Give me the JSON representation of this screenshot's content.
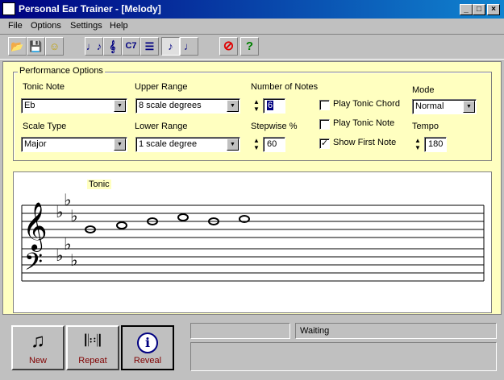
{
  "window": {
    "title": "Personal Ear Trainer - [Melody]"
  },
  "caption_buttons": [
    "_",
    "□",
    "×"
  ],
  "menu": [
    "File",
    "Options",
    "Settings",
    "Help"
  ],
  "toolbar": [
    {
      "icon": "open-folder-icon",
      "glyph": "📂"
    },
    {
      "icon": "save-icon",
      "glyph": "💾"
    },
    {
      "icon": "smiley-icon",
      "glyph": "☺"
    },
    {
      "icon": "interval-icon",
      "glyph": "♩♪"
    },
    {
      "icon": "scale-icon",
      "glyph": "𝄞"
    },
    {
      "icon": "chord-icon",
      "glyph": "C7"
    },
    {
      "icon": "progression-icon",
      "glyph": "☰"
    },
    {
      "icon": "melody-icon",
      "glyph": "♪"
    },
    {
      "icon": "rhythm-icon",
      "glyph": "♩"
    },
    {
      "icon": "stop-icon",
      "glyph": "⊘"
    },
    {
      "icon": "help-icon",
      "glyph": "?"
    }
  ],
  "performance": {
    "legend": "Performance Options",
    "tonic_note_label": "Tonic Note",
    "tonic_note": "Eb",
    "scale_type_label": "Scale Type",
    "scale_type": "Major",
    "upper_range_label": "Upper Range",
    "upper_range": "8 scale degrees",
    "lower_range_label": "Lower Range",
    "lower_range": "1 scale degree",
    "num_notes_label": "Number of Notes",
    "num_notes": "6",
    "stepwise_label": "Stepwise %",
    "stepwise": "60",
    "play_tonic_chord_label": "Play Tonic Chord",
    "play_tonic_chord": false,
    "play_tonic_note_label": "Play Tonic Note",
    "play_tonic_note": false,
    "show_first_note_label": "Show First Note",
    "show_first_note": true,
    "mode_label": "Mode",
    "mode": "Normal",
    "tempo_label": "Tempo",
    "tempo": "180"
  },
  "staff": {
    "tonic_tag": "Tonic",
    "key_signature": "Eb major (3 flats)",
    "notes": [
      "Eb4",
      "F4",
      "G4",
      "Bb4",
      "G4",
      "A4"
    ]
  },
  "buttons": {
    "new": "New",
    "repeat": "Repeat",
    "reveal": "Reveal"
  },
  "status": {
    "left": "",
    "right": "Waiting",
    "lower": ""
  },
  "colors": {
    "panel_bg": "#ffffc0",
    "title_bar": "#000080",
    "button_caption": "#800000"
  }
}
